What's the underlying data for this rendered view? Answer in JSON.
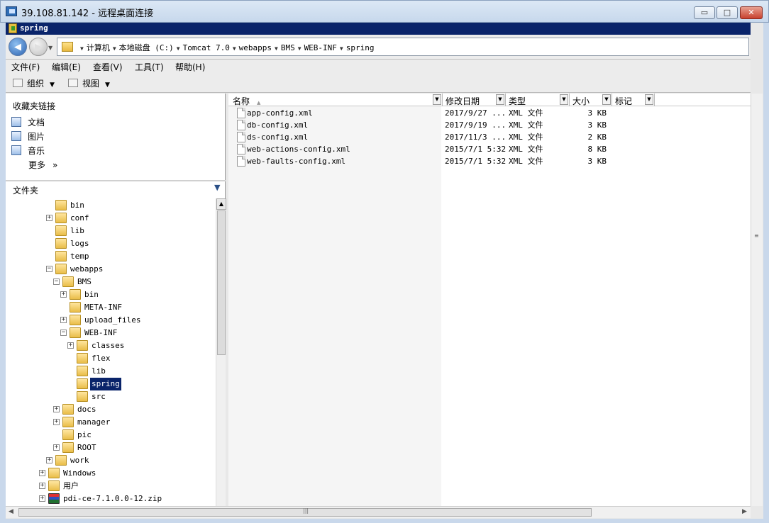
{
  "rdp": {
    "title": "39.108.81.142 - 远程桌面连接",
    "min_label": "▭",
    "max_label": "□",
    "close_label": "✕"
  },
  "explorer": {
    "title": "spring"
  },
  "address": {
    "crumbs": [
      "计算机",
      "本地磁盘 (C:)",
      "Tomcat 7.0",
      "webapps",
      "BMS",
      "WEB-INF",
      "spring"
    ]
  },
  "menu": {
    "items": [
      "文件(F)",
      "编辑(E)",
      "查看(V)",
      "工具(T)",
      "帮助(H)"
    ]
  },
  "toolbar": {
    "organize": "组织",
    "views": "视图"
  },
  "favorites": {
    "title": "收藏夹链接",
    "items": [
      "文档",
      "图片",
      "音乐",
      "更多"
    ],
    "more_chevron": "»"
  },
  "folders": {
    "title": "文件夹",
    "tree": [
      {
        "label": "bin",
        "depth": 2,
        "toggle": ""
      },
      {
        "label": "conf",
        "depth": 2,
        "toggle": "+"
      },
      {
        "label": "lib",
        "depth": 2,
        "toggle": ""
      },
      {
        "label": "logs",
        "depth": 2,
        "toggle": ""
      },
      {
        "label": "temp",
        "depth": 2,
        "toggle": ""
      },
      {
        "label": "webapps",
        "depth": 2,
        "toggle": "-"
      },
      {
        "label": "BMS",
        "depth": 3,
        "toggle": "-"
      },
      {
        "label": "bin",
        "depth": 4,
        "toggle": "+"
      },
      {
        "label": "META-INF",
        "depth": 4,
        "toggle": ""
      },
      {
        "label": "upload_files",
        "depth": 4,
        "toggle": "+"
      },
      {
        "label": "WEB-INF",
        "depth": 4,
        "toggle": "-"
      },
      {
        "label": "classes",
        "depth": 5,
        "toggle": "+"
      },
      {
        "label": "flex",
        "depth": 5,
        "toggle": ""
      },
      {
        "label": "lib",
        "depth": 5,
        "toggle": ""
      },
      {
        "label": "spring",
        "depth": 5,
        "toggle": "",
        "selected": true
      },
      {
        "label": "src",
        "depth": 5,
        "toggle": ""
      },
      {
        "label": "docs",
        "depth": 3,
        "toggle": "+"
      },
      {
        "label": "manager",
        "depth": 3,
        "toggle": "+"
      },
      {
        "label": "pic",
        "depth": 3,
        "toggle": ""
      },
      {
        "label": "ROOT",
        "depth": 3,
        "toggle": "+"
      },
      {
        "label": "work",
        "depth": 2,
        "toggle": "+"
      },
      {
        "label": "Windows",
        "depth": 1,
        "toggle": "+"
      },
      {
        "label": "用户",
        "depth": 1,
        "toggle": "+"
      },
      {
        "label": "pdi-ce-7.1.0.0-12.zip",
        "depth": 1,
        "toggle": "+",
        "zip": true
      }
    ]
  },
  "list": {
    "columns": [
      "名称",
      "修改日期",
      "类型",
      "大小",
      "标记"
    ],
    "sort_indicator": "▲",
    "rows": [
      {
        "name": "app-config.xml",
        "date": "2017/9/27 ...",
        "type": "XML 文件",
        "size": "3 KB"
      },
      {
        "name": "db-config.xml",
        "date": "2017/9/19 ...",
        "type": "XML 文件",
        "size": "3 KB"
      },
      {
        "name": "ds-config.xml",
        "date": "2017/11/3 ...",
        "type": "XML 文件",
        "size": "2 KB"
      },
      {
        "name": "web-actions-config.xml",
        "date": "2015/7/1 5:32",
        "type": "XML 文件",
        "size": "8 KB"
      },
      {
        "name": "web-faults-config.xml",
        "date": "2015/7/1 5:32",
        "type": "XML 文件",
        "size": "3 KB"
      }
    ]
  }
}
